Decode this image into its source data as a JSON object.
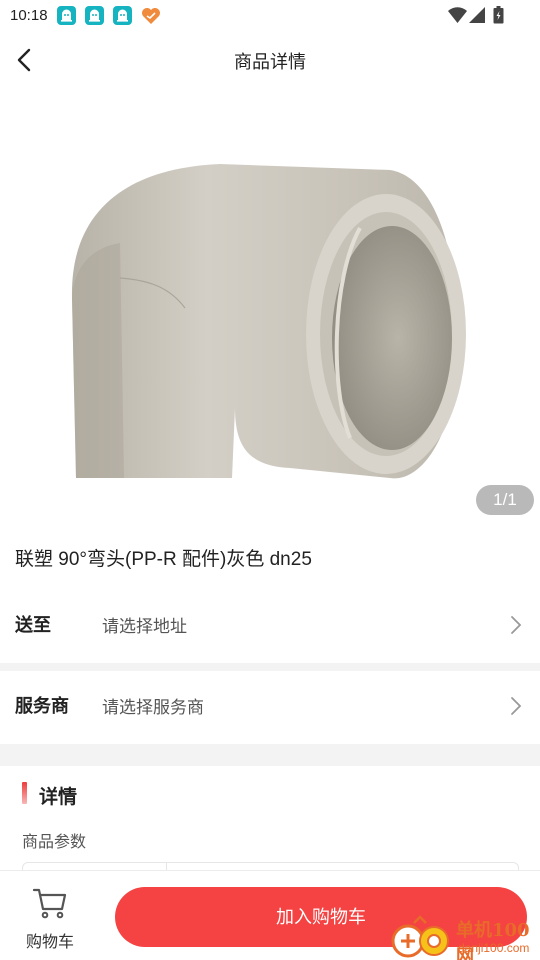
{
  "status_bar": {
    "time": "10:18",
    "notification_icons": [
      "app-notification-icon",
      "app-notification-icon",
      "app-notification-icon",
      "heart-app-icon"
    ],
    "system_icons": [
      "wifi-icon",
      "signal-icon",
      "battery-icon"
    ]
  },
  "navbar": {
    "back_icon": "chevron-left-icon",
    "title": "商品详情"
  },
  "gallery": {
    "image_description": "product-photo",
    "page_indicator": "1/1"
  },
  "product": {
    "name": "联塑 90°弯头(PP-R 配件)灰色 dn25"
  },
  "delivery": {
    "label": "送至",
    "value": "请选择地址"
  },
  "service": {
    "label": "服务商",
    "value": "请选择服务商"
  },
  "details": {
    "title": "详情",
    "params_label": "商品参数"
  },
  "bottom_bar": {
    "cart_label": "购物车",
    "add_to_cart_label": "加入购物车"
  },
  "watermark": {
    "text": "单机100网",
    "url": "danji100.com"
  },
  "colors": {
    "accent": "#f54242",
    "notification_teal": "#16b3c0",
    "indicator_bg": "#b9b9b9"
  }
}
